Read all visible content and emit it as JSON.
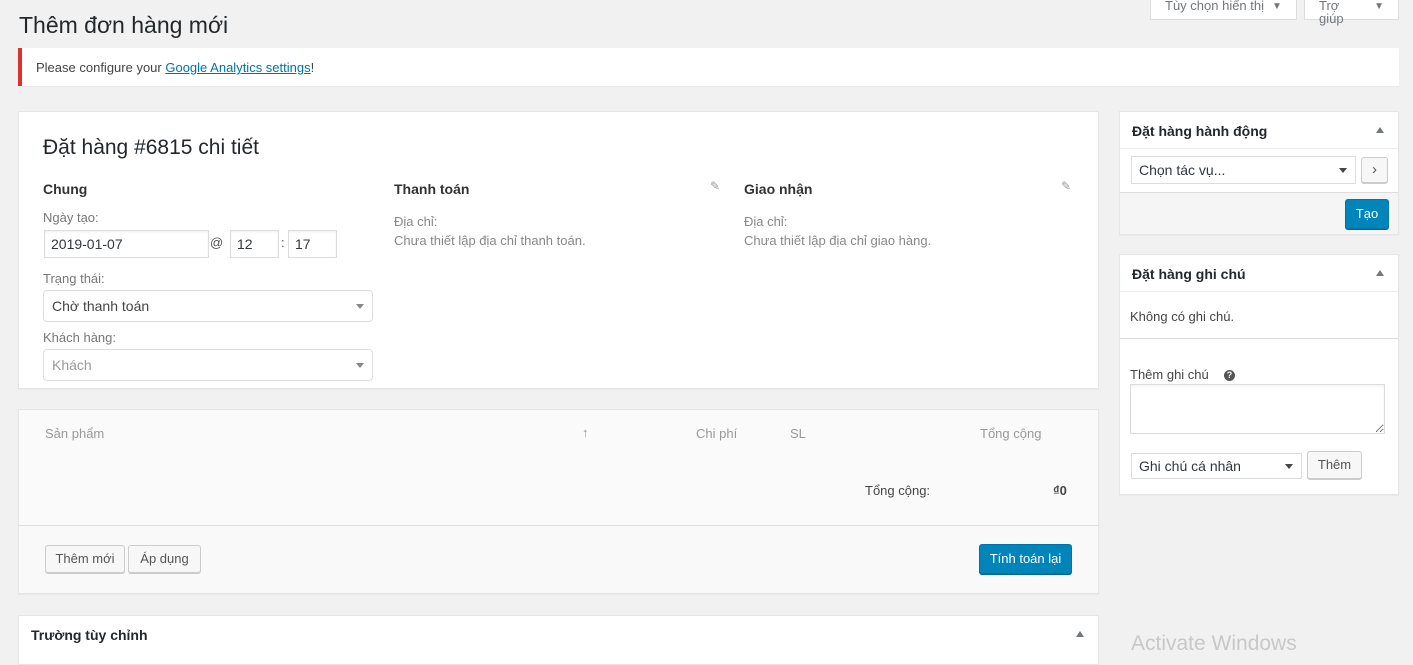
{
  "page": {
    "title": "Thêm đơn hàng mới"
  },
  "screen_meta": {
    "screen_options": "Tùy chọn hiển thị",
    "help": "Trợ giúp"
  },
  "notice": {
    "text_before": "Please configure your ",
    "link": "Google Analytics settings",
    "text_after": "!"
  },
  "order": {
    "heading": "Đặt hàng #6815 chi tiết",
    "general": {
      "title": "Chung",
      "date_label": "Ngày tạo:",
      "date_value": "2019-01-07",
      "at": "@",
      "hour": "12",
      "colon": ":",
      "minute": "17",
      "status_label": "Trạng thái:",
      "status_value": "Chờ thanh toán",
      "customer_label": "Khách hàng:",
      "customer_placeholder": "Khách"
    },
    "billing": {
      "title": "Thanh toán",
      "address_label": "Địa chỉ:",
      "address_value": "Chưa thiết lập địa chỉ thanh toán."
    },
    "shipping": {
      "title": "Giao nhận",
      "address_label": "Địa chỉ:",
      "address_value": "Chưa thiết lập địa chỉ giao hàng."
    }
  },
  "items": {
    "columns": {
      "product": "Sản phẩm",
      "sort": "↑",
      "cost": "Chi phí",
      "qty": "SL",
      "total": "Tổng cộng"
    },
    "total_label": "Tổng cộng:",
    "total_value": "₫0",
    "add_button": "Thêm mới",
    "apply_button": "Áp dụng",
    "recalc_button": "Tính toán lại"
  },
  "custom_fields": {
    "title": "Trường tùy chỉnh"
  },
  "order_actions": {
    "title": "Đặt hàng hành động",
    "select_value": "Chọn tác vụ...",
    "go_button": "›",
    "create_button": "Tạo"
  },
  "order_notes": {
    "title": "Đặt hàng ghi chú",
    "empty": "Không có ghi chú.",
    "add_label": "Thêm ghi chú",
    "help": "?",
    "note_type": "Ghi chú cá nhân",
    "add_button": "Thêm"
  },
  "watermark": "Activate Windows",
  "colors": {
    "primary": "#0085ba",
    "notice_error": "#dc3232",
    "link": "#0073aa"
  }
}
